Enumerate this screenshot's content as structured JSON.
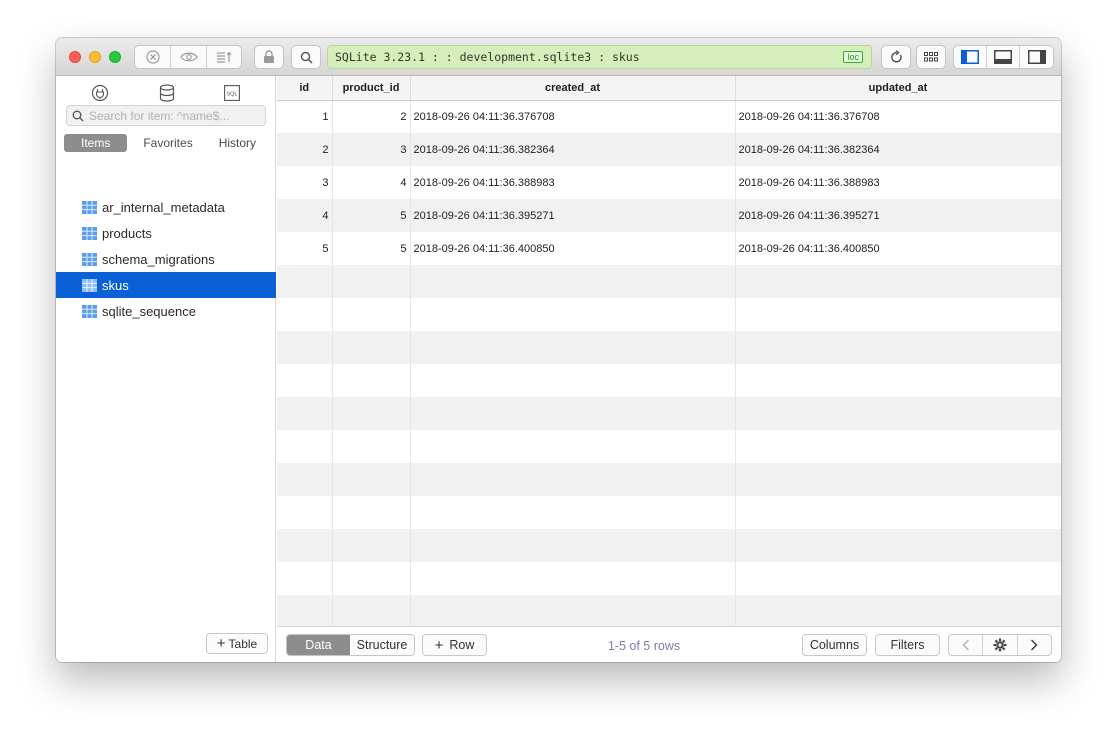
{
  "connection": {
    "text": "SQLite 3.23.1 :  : development.sqlite3 : skus",
    "badge": "loc",
    "color": "#d6eebc"
  },
  "sidebar": {
    "search_placeholder": "Search for item: ^name$...",
    "tabs": [
      "Items",
      "Favorites",
      "History"
    ],
    "active_tab": "Items",
    "items": [
      {
        "label": "ar_internal_metadata",
        "icon": "table-icon"
      },
      {
        "label": "products",
        "icon": "table-icon"
      },
      {
        "label": "schema_migrations",
        "icon": "table-icon"
      },
      {
        "label": "skus",
        "icon": "table-icon",
        "selected": true
      },
      {
        "label": "sqlite_sequence",
        "icon": "table-icon"
      }
    ],
    "add_table_label": "Table",
    "selection_color": "#0a60d6"
  },
  "grid": {
    "columns": [
      "id",
      "product_id",
      "created_at",
      "updated_at"
    ],
    "rows": [
      [
        "1",
        "2",
        "2018-09-26 04:11:36.376708",
        "2018-09-26 04:11:36.376708"
      ],
      [
        "2",
        "3",
        "2018-09-26 04:11:36.382364",
        "2018-09-26 04:11:36.382364"
      ],
      [
        "3",
        "4",
        "2018-09-26 04:11:36.388983",
        "2018-09-26 04:11:36.388983"
      ],
      [
        "4",
        "5",
        "2018-09-26 04:11:36.395271",
        "2018-09-26 04:11:36.395271"
      ],
      [
        "5",
        "5",
        "2018-09-26 04:11:36.400850",
        "2018-09-26 04:11:36.400850"
      ]
    ]
  },
  "bottombar": {
    "data_label": "Data",
    "structure_label": "Structure",
    "add_row_label": "Row",
    "row_count": "1-5 of 5 rows",
    "columns_label": "Columns",
    "filters_label": "Filters"
  }
}
